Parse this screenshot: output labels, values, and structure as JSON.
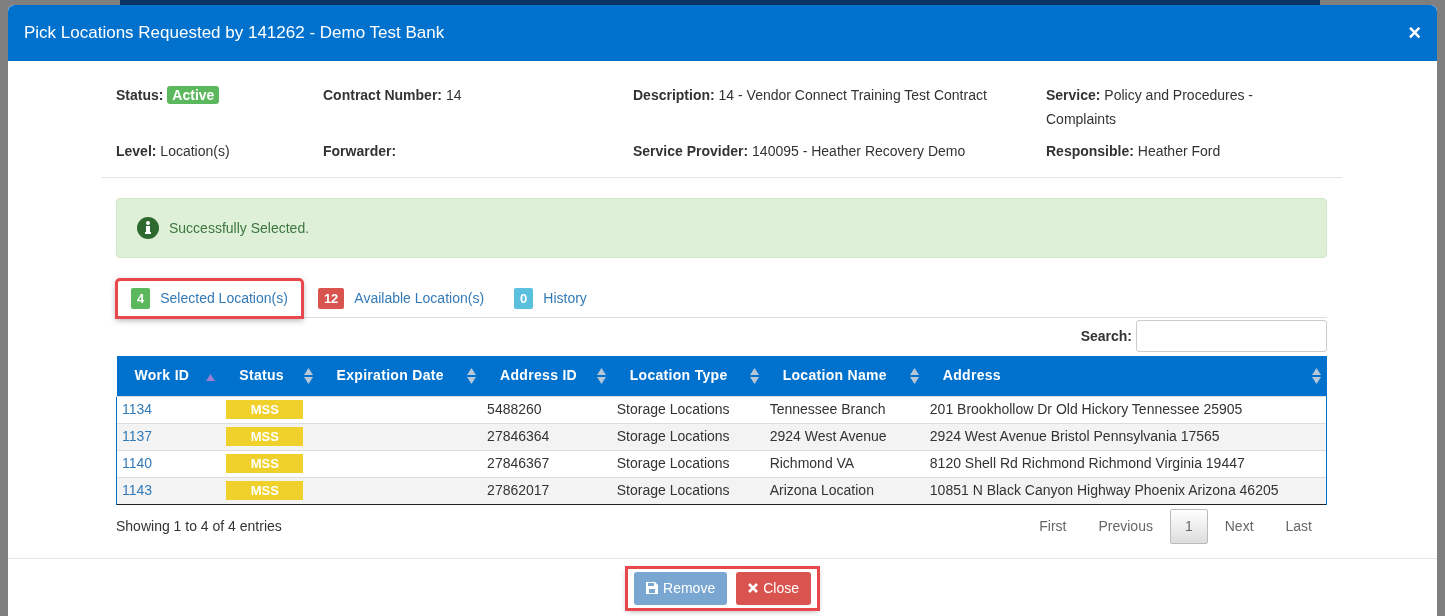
{
  "modal": {
    "title": "Pick Locations Requested by 141262 - Demo Test Bank",
    "close": "×"
  },
  "details": [
    {
      "label": "Status:",
      "badge": "Active"
    },
    {
      "label": "Contract Number:",
      "value": "14"
    },
    {
      "label": "Description:",
      "value": "14 - Vendor Connect Training Test Contract"
    },
    {
      "label": "Service:",
      "value": "Policy and Procedures - Complaints"
    },
    {
      "label": "Level:",
      "value": "Location(s)"
    },
    {
      "label": "Forwarder:"
    },
    {
      "label": "Service Provider:",
      "value": "140095 - Heather Recovery Demo"
    },
    {
      "label": "Responsible:",
      "value": "Heather Ford"
    }
  ],
  "alert": {
    "text": "Successfully Selected."
  },
  "tabs": [
    {
      "count": "4",
      "label": "Selected Location(s)",
      "selected": true,
      "color": "#5cb85c",
      "highlighted": true
    },
    {
      "count": "12",
      "label": "Available Location(s)",
      "selected": false,
      "color": "#d9534f",
      "highlighted": false
    },
    {
      "count": "0",
      "label": "History",
      "selected": false,
      "color": "#5bc0de",
      "highlighted": false
    }
  ],
  "search": {
    "label": "Search:"
  },
  "table": {
    "columns": [
      {
        "label": "Work ID",
        "sorted_ascending": true
      },
      {
        "label": "Status",
        "sorted_ascending": false
      },
      {
        "label": "Expiration Date",
        "sorted_ascending": false
      },
      {
        "label": "Address ID",
        "sorted_ascending": false
      },
      {
        "label": "Location Type",
        "sorted_ascending": false
      },
      {
        "label": "Location Name",
        "sorted_ascending": false
      },
      {
        "label": "Address",
        "sorted_ascending": false
      }
    ],
    "rows": [
      {
        "work_id": "1134",
        "status": "MSS",
        "expiration_date": "",
        "address_id": "5488260",
        "location_type": "Storage Locations",
        "location_name": "Tennessee Branch",
        "address": "201 Brookhollow Dr Old Hickory Tennessee 25905"
      },
      {
        "work_id": "1137",
        "status": "MSS",
        "expiration_date": "",
        "address_id": "27846364",
        "location_type": "Storage Locations",
        "location_name": "2924 West Avenue",
        "address": "2924 West Avenue Bristol Pennsylvania 17565"
      },
      {
        "work_id": "1140",
        "status": "MSS",
        "expiration_date": "",
        "address_id": "27846367",
        "location_type": "Storage Locations",
        "location_name": "Richmond VA",
        "address": "8120 Shell Rd Richmond Richmond Virginia 19447"
      },
      {
        "work_id": "1143",
        "status": "MSS",
        "expiration_date": "",
        "address_id": "27862017",
        "location_type": "Storage Locations",
        "location_name": "Arizona Location",
        "address": "10851 N Black Canyon Highway Phoenix Arizona 46205"
      }
    ]
  },
  "info": "Showing 1 to 4 of 4 entries",
  "pagination": [
    {
      "label": "First",
      "selected": false
    },
    {
      "label": "Previous",
      "selected": false
    },
    {
      "label": "1",
      "selected": true
    },
    {
      "label": "Next",
      "selected": false
    },
    {
      "label": "Last",
      "selected": false
    }
  ],
  "footer": {
    "highlighted": true,
    "buttons": [
      {
        "kind": "remove",
        "label": "Remove"
      },
      {
        "kind": "close",
        "label": "Close"
      }
    ]
  }
}
